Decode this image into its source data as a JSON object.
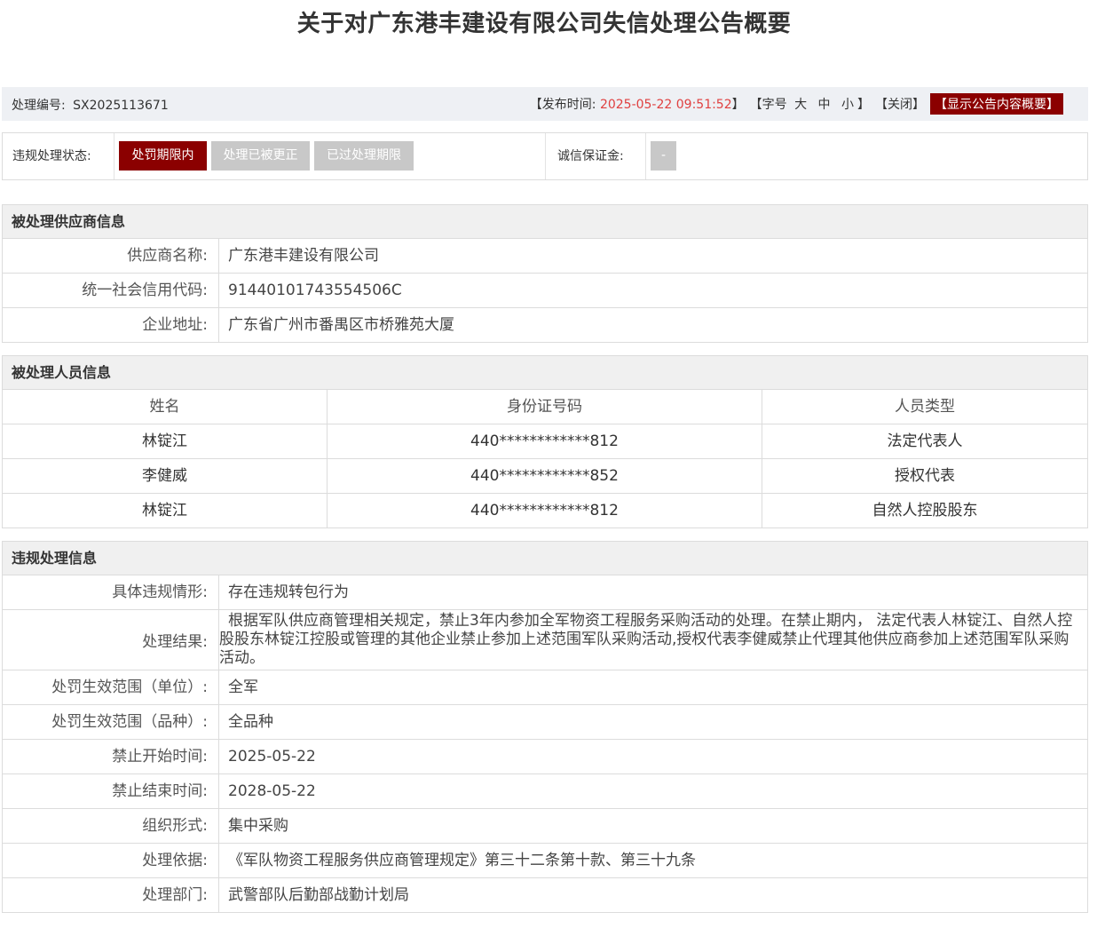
{
  "title": "关于对广东港丰建设有限公司失信处理公告概要",
  "meta": {
    "number_label": "处理编号:",
    "number_value": "SX2025113671",
    "publish_prefix": "【发布时间: ",
    "publish_time": "2025-05-22 09:51:52",
    "publish_suffix": "】",
    "font_prefix": "【字号",
    "font_large": "大",
    "font_medium": "中",
    "font_small": "小",
    "font_suffix": "】",
    "close_label": "【关闭】",
    "show_summary_label": "【显示公告内容概要】"
  },
  "status": {
    "label": "违规处理状态:",
    "buttons": [
      {
        "label": "处罚期限内",
        "active": true,
        "color": "#8b0000"
      },
      {
        "label": "处理已被更正",
        "active": false,
        "color": "#c8c8c8"
      },
      {
        "label": "已过处理期限",
        "active": false,
        "color": "#c8c8c8"
      }
    ],
    "deposit_label": "诚信保证金:",
    "deposit_value": "-"
  },
  "supplier": {
    "heading": "被处理供应商信息",
    "rows": [
      {
        "label": "供应商名称:",
        "value": "广东港丰建设有限公司"
      },
      {
        "label": "统一社会信用代码:",
        "value": "91440101743554506C"
      },
      {
        "label": "企业地址:",
        "value": "广东省广州市番禺区市桥雅苑大厦"
      }
    ]
  },
  "persons": {
    "heading": "被处理人员信息",
    "columns": [
      "姓名",
      "身份证号码",
      "人员类型"
    ],
    "rows": [
      [
        "林锭江",
        "440************812",
        "法定代表人"
      ],
      [
        "李健威",
        "440************852",
        "授权代表"
      ],
      [
        "林锭江",
        "440************812",
        "自然人控股股东"
      ]
    ]
  },
  "violation": {
    "heading": "违规处理信息",
    "rows": [
      {
        "label": "具体违规情形:",
        "value": "存在违规转包行为"
      },
      {
        "label": "处理结果:",
        "value": "根据军队供应商管理相关规定，禁止3年内参加全军物资工程服务采购活动的处理。在禁止期内， 法定代表人林锭江、自然人控股股东林锭江控股或管理的其他企业禁止参加上述范围军队采购活动,授权代表李健威禁止代理其他供应商参加上述范围军队采购活动。"
      },
      {
        "label": "处罚生效范围（单位）:",
        "value": "全军"
      },
      {
        "label": "处罚生效范围（品种）:",
        "value": "全品种"
      },
      {
        "label": "禁止开始时间:",
        "value": "2025-05-22"
      },
      {
        "label": "禁止结束时间:",
        "value": "2028-05-22"
      },
      {
        "label": "组织形式:",
        "value": "集中采购"
      },
      {
        "label": "处理依据:",
        "value": "《军队物资工程服务供应商管理规定》第三十二条第十款、第三十九条"
      },
      {
        "label": "处理部门:",
        "value": "武警部队后勤部战勤计划局"
      }
    ]
  }
}
